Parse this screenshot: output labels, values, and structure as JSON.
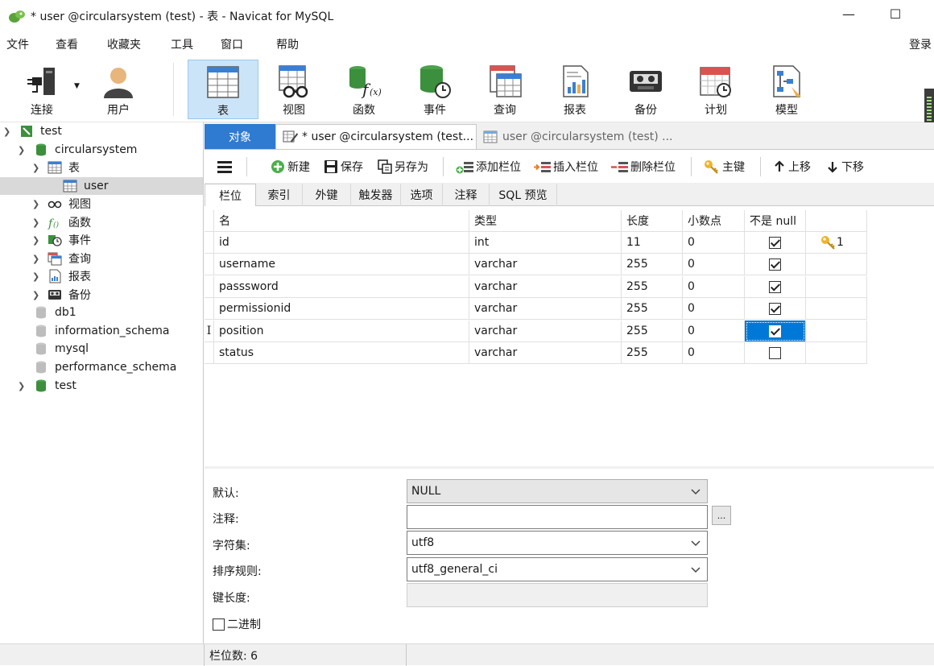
{
  "window": {
    "title": "* user @circularsystem (test) - 表 - Navicat for MySQL",
    "minimize": "—",
    "maximize": "☐"
  },
  "menu": [
    "文件",
    "查看",
    "收藏夹",
    "工具",
    "窗口",
    "帮助"
  ],
  "login_label": "登录",
  "toolbar": [
    {
      "label": "连接",
      "icon": "plug-connection-icon"
    },
    {
      "label": "用户",
      "icon": "user-icon"
    },
    {
      "label": "表",
      "icon": "table-icon",
      "active": true
    },
    {
      "label": "视图",
      "icon": "view-glasses-icon"
    },
    {
      "label": "函数",
      "icon": "function-icon"
    },
    {
      "label": "事件",
      "icon": "event-clock-icon"
    },
    {
      "label": "查询",
      "icon": "query-icon"
    },
    {
      "label": "报表",
      "icon": "report-icon"
    },
    {
      "label": "备份",
      "icon": "backup-tape-icon"
    },
    {
      "label": "计划",
      "icon": "schedule-calendar-icon"
    },
    {
      "label": "模型",
      "icon": "model-icon"
    }
  ],
  "sidebar": {
    "items": [
      {
        "label": "test"
      },
      {
        "label": "circularsystem"
      },
      {
        "label": "表"
      },
      {
        "label": "user"
      },
      {
        "label": "视图"
      },
      {
        "label": "函数"
      },
      {
        "label": "事件"
      },
      {
        "label": "查询"
      },
      {
        "label": "报表"
      },
      {
        "label": "备份"
      },
      {
        "label": "db1"
      },
      {
        "label": "information_schema"
      },
      {
        "label": "mysql"
      },
      {
        "label": "performance_schema"
      },
      {
        "label": "test"
      }
    ]
  },
  "tabs": {
    "objects": "对象",
    "current": "* user @circularsystem (test...",
    "other": "user @circularsystem (test) ..."
  },
  "design_toolbar": {
    "new": "新建",
    "save": "保存",
    "save_as": "另存为",
    "add_field": "添加栏位",
    "insert_field": "插入栏位",
    "delete_field": "删除栏位",
    "primary_key": "主键",
    "move_up": "上移",
    "move_down": "下移"
  },
  "subtabs": [
    "栏位",
    "索引",
    "外键",
    "触发器",
    "选项",
    "注释",
    "SQL 预览"
  ],
  "grid": {
    "headers": [
      "名",
      "类型",
      "长度",
      "小数点",
      "不是 null"
    ],
    "rows": [
      {
        "name": "id",
        "type": "int",
        "length": "11",
        "decimals": "0",
        "not_null": true,
        "key": "1"
      },
      {
        "name": "username",
        "type": "varchar",
        "length": "255",
        "decimals": "0",
        "not_null": true,
        "key": ""
      },
      {
        "name": "passsword",
        "type": "varchar",
        "length": "255",
        "decimals": "0",
        "not_null": true,
        "key": ""
      },
      {
        "name": "permissionid",
        "type": "varchar",
        "length": "255",
        "decimals": "0",
        "not_null": true,
        "key": ""
      },
      {
        "name": "position",
        "type": "varchar",
        "length": "255",
        "decimals": "0",
        "not_null": true,
        "key": ""
      },
      {
        "name": "status",
        "type": "varchar",
        "length": "255",
        "decimals": "0",
        "not_null": false,
        "key": ""
      }
    ],
    "row_cursor": "I"
  },
  "props": {
    "default_label": "默认:",
    "default_value": "NULL",
    "comment_label": "注释:",
    "comment_value": "",
    "comment_button": "...",
    "charset_label": "字符集:",
    "charset_value": "utf8",
    "collation_label": "排序规则:",
    "collation_value": "utf8_general_ci",
    "keylen_label": "键长度:",
    "keylen_value": "",
    "binary_label": "二进制"
  },
  "status": {
    "field_count": "栏位数: 6"
  }
}
